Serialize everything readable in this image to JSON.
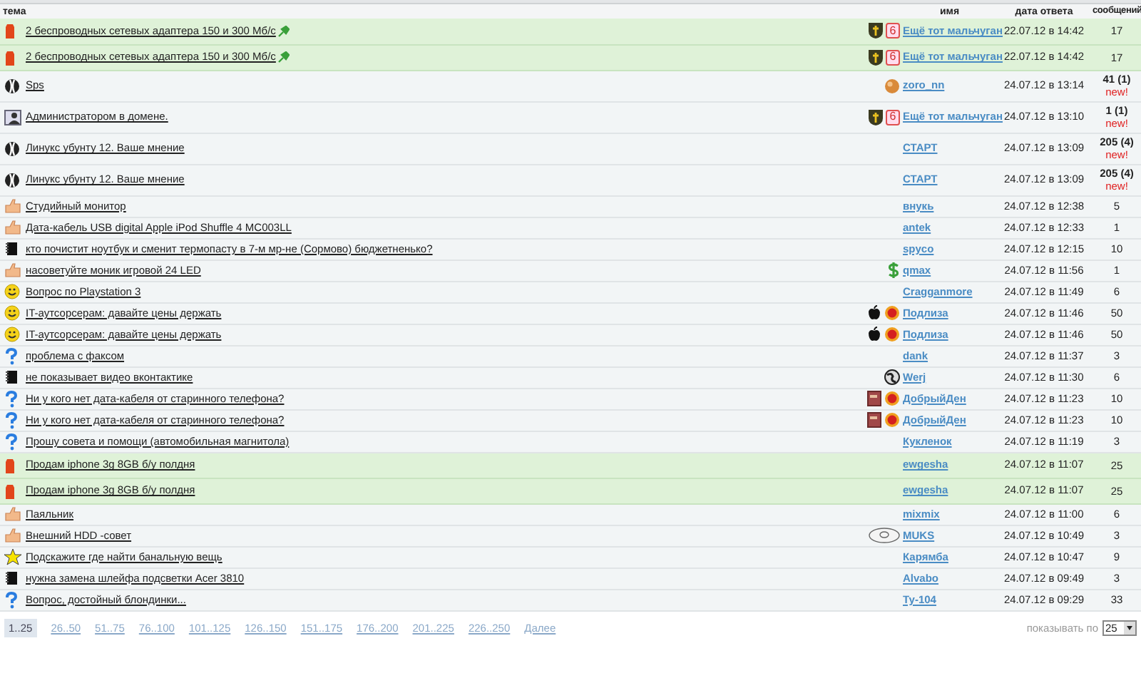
{
  "columns": {
    "topic": "тема",
    "author": "имя",
    "date": "дата ответа",
    "count": "сообщений"
  },
  "rows": [
    {
      "kind": "bag",
      "title": "2 беспроводных сетевых адаптера 150 и 300 Мб/с",
      "pinned": true,
      "highlighted": true,
      "badges": [
        {
          "kind": "shield"
        },
        {
          "kind": "number",
          "text": "6"
        }
      ],
      "author": "Ещё тот мальчуган",
      "date": "22.07.12 в 14:42",
      "count": "17",
      "new": false
    },
    {
      "kind": "bag",
      "title": "2 беспроводных сетевых адаптера 150 и 300 Мб/с",
      "pinned": true,
      "highlighted": true,
      "badges": [
        {
          "kind": "shield"
        },
        {
          "kind": "number",
          "text": "6"
        }
      ],
      "author": "Ещё тот мальчуган",
      "date": "22.07.12 в 14:42",
      "count": "17",
      "new": false
    },
    {
      "kind": "ball",
      "title": "Sps",
      "pinned": false,
      "highlighted": false,
      "badges": [
        {
          "kind": "orb"
        }
      ],
      "author": "zoro_nn",
      "date": "24.07.12 в 13:14",
      "count": "41 (1)",
      "new": true,
      "new_label": "new!"
    },
    {
      "kind": "person",
      "title": "Администратором в домене.",
      "pinned": false,
      "highlighted": false,
      "badges": [
        {
          "kind": "shield"
        },
        {
          "kind": "number",
          "text": "6"
        }
      ],
      "author": "Ещё тот мальчуган",
      "date": "24.07.12 в 13:10",
      "count": "1 (1)",
      "new": true,
      "new_label": "new!"
    },
    {
      "kind": "ball",
      "title": "Линукс убунту 12. Ваше мнение",
      "pinned": false,
      "highlighted": false,
      "badges": [],
      "author": "СТАРТ",
      "date": "24.07.12 в 13:09",
      "count": "205 (4)",
      "new": true,
      "new_label": "new!"
    },
    {
      "kind": "ball",
      "title": "Линукс убунту 12. Ваше мнение",
      "pinned": false,
      "highlighted": false,
      "badges": [],
      "author": "СТАРТ",
      "date": "24.07.12 в 13:09",
      "count": "205 (4)",
      "new": true,
      "new_label": "new!"
    },
    {
      "kind": "thumb",
      "title": "Студийный монитор",
      "pinned": false,
      "highlighted": false,
      "badges": [],
      "author": "внукь",
      "date": "24.07.12 в 12:38",
      "count": "5",
      "new": false
    },
    {
      "kind": "thumb",
      "title": "Дата-кабель USB digital Apple iPod Shuffle 4 MC003LL",
      "pinned": false,
      "highlighted": false,
      "badges": [],
      "author": "antek",
      "date": "24.07.12 в 12:33",
      "count": "1",
      "new": false
    },
    {
      "kind": "notebook",
      "title": "кто почистит ноутбук и сменит термопасту в 7-м мр-не (Сормово) бюджетненько?",
      "pinned": false,
      "highlighted": false,
      "badges": [],
      "author": "spyco",
      "date": "24.07.12 в 12:15",
      "count": "10",
      "new": false
    },
    {
      "kind": "thumb",
      "title": "насоветуйте моник игровой 24 LED",
      "pinned": false,
      "highlighted": false,
      "badges": [
        {
          "kind": "dollar"
        }
      ],
      "author": "qmax",
      "date": "24.07.12 в 11:56",
      "count": "1",
      "new": false
    },
    {
      "kind": "smile",
      "title": "Вопрос по Playstation 3",
      "pinned": false,
      "highlighted": false,
      "badges": [],
      "author": "Cragganmore",
      "date": "24.07.12 в 11:49",
      "count": "6",
      "new": false
    },
    {
      "kind": "smile",
      "title": "IT-аутсорсерам: давайте цены держать",
      "pinned": false,
      "highlighted": false,
      "badges": [
        {
          "kind": "apple"
        },
        {
          "kind": "seal"
        }
      ],
      "author": "Подлиза",
      "date": "24.07.12 в 11:46",
      "count": "50",
      "new": false
    },
    {
      "kind": "smile",
      "title": "IT-аутсорсерам: давайте цены держать",
      "pinned": false,
      "highlighted": false,
      "badges": [
        {
          "kind": "apple"
        },
        {
          "kind": "seal"
        }
      ],
      "author": "Подлиза",
      "date": "24.07.12 в 11:46",
      "count": "50",
      "new": false
    },
    {
      "kind": "question",
      "title": "проблема с факсом",
      "pinned": false,
      "highlighted": false,
      "badges": [],
      "author": "dank",
      "date": "24.07.12 в 11:37",
      "count": "3",
      "new": false
    },
    {
      "kind": "notebook",
      "title": "не показывает видео вконтактике",
      "pinned": false,
      "highlighted": false,
      "badges": [
        {
          "kind": "globe"
        }
      ],
      "author": "Werj",
      "date": "24.07.12 в 11:30",
      "count": "6",
      "new": false
    },
    {
      "kind": "question",
      "title": "Ни у кого нет дата-кабеля от старинного телефона?",
      "pinned": false,
      "highlighted": false,
      "badges": [
        {
          "kind": "book"
        },
        {
          "kind": "seal"
        }
      ],
      "author": "ДобрыйДен",
      "date": "24.07.12 в 11:23",
      "count": "10",
      "new": false
    },
    {
      "kind": "question",
      "title": "Ни у кого нет дата-кабеля от старинного телефона?",
      "pinned": false,
      "highlighted": false,
      "badges": [
        {
          "kind": "book"
        },
        {
          "kind": "seal"
        }
      ],
      "author": "ДобрыйДен",
      "date": "24.07.12 в 11:23",
      "count": "10",
      "new": false
    },
    {
      "kind": "question",
      "title": "Прошу совета и помощи (автомобильная магнитола)",
      "pinned": false,
      "highlighted": false,
      "badges": [],
      "author": "Кукленок",
      "date": "24.07.12 в 11:19",
      "count": "3",
      "new": false
    },
    {
      "kind": "bag",
      "title": "Продам iphone 3g 8GB б/у полдня",
      "pinned": false,
      "highlighted": true,
      "badges": [],
      "author": "ewgesha",
      "date": "24.07.12 в 11:07",
      "count": "25",
      "new": false
    },
    {
      "kind": "bag",
      "title": "Продам iphone 3g 8GB б/у полдня",
      "pinned": false,
      "highlighted": true,
      "badges": [],
      "author": "ewgesha",
      "date": "24.07.12 в 11:07",
      "count": "25",
      "new": false
    },
    {
      "kind": "thumb",
      "title": "Паяльник",
      "pinned": false,
      "highlighted": false,
      "badges": [],
      "author": "mixmix",
      "date": "24.07.12 в 11:00",
      "count": "6",
      "new": false
    },
    {
      "kind": "thumb",
      "title": "Внешний HDD -совет",
      "pinned": false,
      "highlighted": false,
      "badges": [
        {
          "kind": "disc"
        }
      ],
      "author": "MUKS",
      "date": "24.07.12 в 10:49",
      "count": "3",
      "new": false
    },
    {
      "kind": "star",
      "title": "Подскажите где найти банальную вещь",
      "pinned": false,
      "highlighted": false,
      "badges": [],
      "author": "Карямба",
      "date": "24.07.12 в 10:47",
      "count": "9",
      "new": false
    },
    {
      "kind": "notebook",
      "title": "нужна замена шлейфа подсветки Acer 3810",
      "pinned": false,
      "highlighted": false,
      "badges": [],
      "author": "Alvabo",
      "date": "24.07.12 в 09:49",
      "count": "3",
      "new": false
    },
    {
      "kind": "question",
      "title": "Вопрос, достойный блондинки...",
      "pinned": false,
      "highlighted": false,
      "badges": [],
      "author": "Ту-104",
      "date": "24.07.12 в 09:29",
      "count": "33",
      "new": false
    }
  ],
  "pagination": {
    "pages": [
      {
        "label": "1..25",
        "selected": true
      },
      {
        "label": "26..50",
        "selected": false
      },
      {
        "label": "51..75",
        "selected": false
      },
      {
        "label": "76..100",
        "selected": false
      },
      {
        "label": "101..125",
        "selected": false
      },
      {
        "label": "126..150",
        "selected": false
      },
      {
        "label": "151..175",
        "selected": false
      },
      {
        "label": "176..200",
        "selected": false
      },
      {
        "label": "201..225",
        "selected": false
      },
      {
        "label": "226..250",
        "selected": false
      }
    ],
    "next": "Далее"
  },
  "per_page": {
    "label": "показывать по",
    "value": "25"
  }
}
